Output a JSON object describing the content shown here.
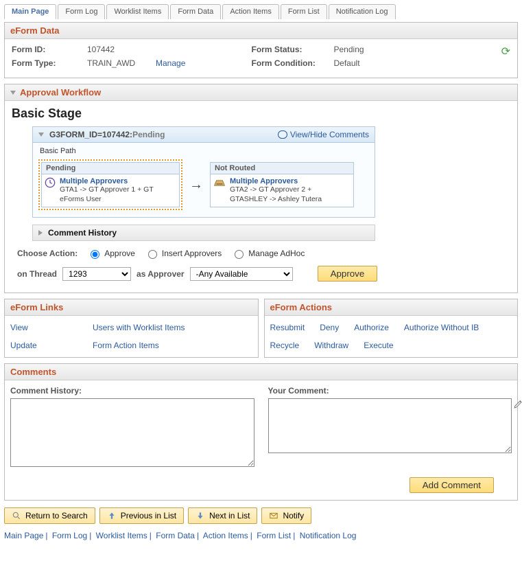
{
  "tabs": [
    "Main Page",
    "Form Log",
    "Worklist Items",
    "Form Data",
    "Action Items",
    "Form List",
    "Notification Log"
  ],
  "active_tab": 0,
  "eform_data": {
    "title": "eForm Data",
    "form_id_label": "Form ID:",
    "form_id": "107442",
    "form_type_label": "Form Type:",
    "form_type": "TRAIN_AWD",
    "manage_link": "Manage",
    "form_status_label": "Form Status:",
    "form_status": "Pending",
    "form_condition_label": "Form Condition:",
    "form_condition": "Default"
  },
  "approval": {
    "title": "Approval Workflow",
    "stage_title": "Basic Stage",
    "wf_id": "G3FORM_ID=107442:",
    "wf_status": "Pending",
    "view_comments": "View/Hide Comments",
    "path_label": "Basic Path",
    "step1": {
      "head": "Pending",
      "link": "Multiple Approvers",
      "detail": "GTA1 -> GT Approver 1 + GT eForms User"
    },
    "step2": {
      "head": "Not Routed",
      "link": "Multiple Approvers",
      "detail": "GTA2 -> GT Approver 2 + GTASHLEY -> Ashley Tutera"
    },
    "comment_history": "Comment History",
    "choose_action_label": "Choose Action:",
    "opt_approve": "Approve",
    "opt_insert": "Insert Approvers",
    "opt_adhoc": "Manage AdHoc",
    "on_thread_label": "on Thread",
    "thread_options": [
      "1293"
    ],
    "as_approver_label": "as Approver",
    "approver_options": [
      "-Any Available"
    ],
    "approve_btn": "Approve"
  },
  "eform_links": {
    "title": "eForm Links",
    "items": [
      "View",
      "Users with Worklist Items",
      "Update",
      "Form Action Items"
    ]
  },
  "eform_actions": {
    "title": "eForm Actions",
    "items": [
      "Resubmit",
      "Deny",
      "Authorize",
      "Authorize Without IB",
      "Recycle",
      "Withdraw",
      "Execute"
    ]
  },
  "comments": {
    "title": "Comments",
    "history_label": "Comment History:",
    "your_label": "Your Comment:",
    "add_btn": "Add Comment"
  },
  "bottom": {
    "return": "Return to Search",
    "prev": "Previous in List",
    "next": "Next in List",
    "notify": "Notify"
  },
  "footer_links": [
    "Main Page",
    "Form Log",
    "Worklist Items",
    "Form Data",
    "Action Items",
    "Form List",
    "Notification Log"
  ]
}
